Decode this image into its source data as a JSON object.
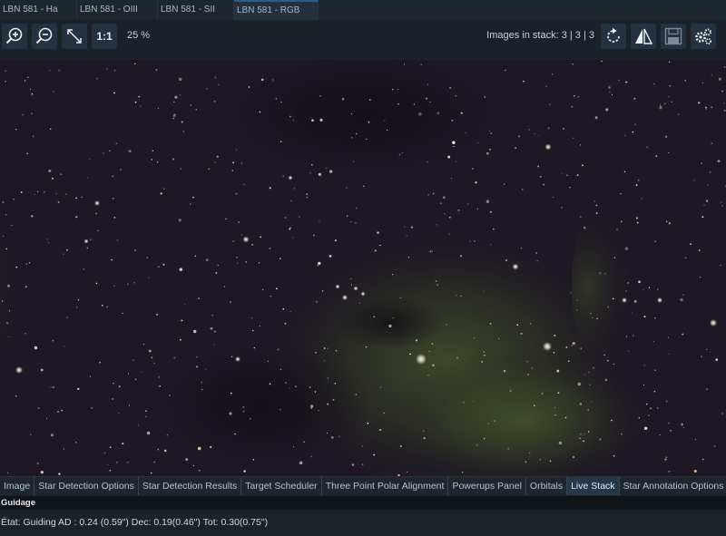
{
  "doc_tabs": [
    {
      "label": "LBN 581 - Ha",
      "active": false
    },
    {
      "label": "LBN 581 - OIII",
      "active": false
    },
    {
      "label": "LBN 581 - SII",
      "active": false
    },
    {
      "label": "LBN 581 - RGB",
      "active": true
    }
  ],
  "toolbar": {
    "zoom_in_icon": "zoom-in-icon",
    "zoom_out_icon": "zoom-out-icon",
    "fit_icon": "fit-to-screen-icon",
    "one_to_one_label": "1:1",
    "zoom_level": "25 %",
    "stack_info": "Images in stack: 3 | 3 | 3",
    "reset_icon": "reset-stack-icon",
    "flip_icon": "flip-icon",
    "save_icon": "save-icon",
    "settings_icon": "settings-icon"
  },
  "viewport": {
    "description_colors": {
      "background": "#1c1722",
      "nebula": "#3d4a26"
    }
  },
  "panel_tabs": [
    {
      "label": "Image",
      "active": false
    },
    {
      "label": "Star Detection Options",
      "active": false
    },
    {
      "label": "Star Detection Results",
      "active": false
    },
    {
      "label": "Target Scheduler",
      "active": false
    },
    {
      "label": "Three Point Polar Alignment",
      "active": false
    },
    {
      "label": "Powerups Panel",
      "active": false
    },
    {
      "label": "Orbitals",
      "active": false
    },
    {
      "label": "Live Stack",
      "active": true
    },
    {
      "label": "Star Annotation Options",
      "active": false
    }
  ],
  "guidage": {
    "title": "Guidage",
    "status": "État: Guiding  AD : 0.24 (0.59\")  Dec: 0.19(0.46\")  Tot: 0.30(0.75\")"
  }
}
